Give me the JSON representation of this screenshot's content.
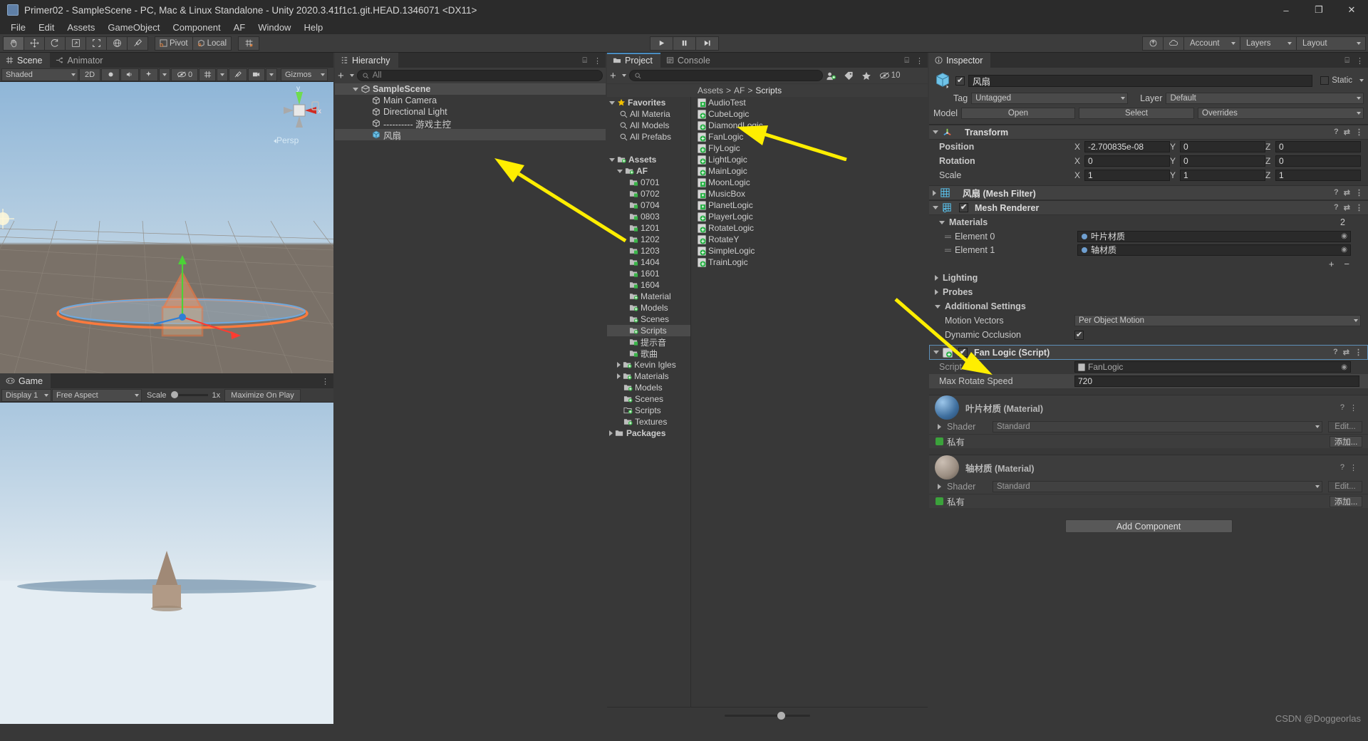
{
  "window": {
    "title": "Primer02 - SampleScene - PC, Mac & Linux Standalone - Unity 2020.3.41f1c1.git.HEAD.1346071 <DX11>",
    "minimize": "–",
    "maximize": "❐",
    "close": "✕"
  },
  "menubar": [
    "File",
    "Edit",
    "Assets",
    "GameObject",
    "Component",
    "AF",
    "Window",
    "Help"
  ],
  "toolbar": {
    "tools": [
      "hand-tool",
      "move-tool",
      "rotate-tool",
      "scale-tool",
      "rect-tool",
      "transform-tool",
      "custom-tool"
    ],
    "pivot": "Pivot",
    "space": "Local",
    "grid": "grid-snap",
    "play": "▶",
    "pause": "❙❙",
    "step": "▶❙",
    "cloud": "cloud-icon",
    "collab": "collab-icon",
    "account": "Account",
    "layers": "Layers",
    "layout": "Layout"
  },
  "scene": {
    "tabs": [
      {
        "label": "Scene",
        "icon": "grid-icon",
        "active": true
      },
      {
        "label": "Animator",
        "icon": "animator-icon",
        "active": false
      }
    ],
    "shading": "Shaded",
    "mode2d": "2D",
    "lighting": "lighting-icon",
    "audio": "audio-icon",
    "fx": "fx-icon",
    "visibility": "0",
    "grid": "grid-icon",
    "tools": "tools-icon",
    "camera": "camera-icon",
    "gizmos": "Gizmos",
    "gizmo_axes": {
      "y": "y",
      "x": "x",
      "persp": "Persp"
    }
  },
  "game": {
    "tab": "Game",
    "display": "Display 1",
    "aspect": "Free Aspect",
    "scale_label": "Scale",
    "scale_value": "1x",
    "maximize": "Maximize On Play"
  },
  "hierarchy": {
    "tab": "Hierarchy",
    "add": "+",
    "search_placeholder": "All",
    "lock_icon": "lock-icon",
    "menu_icon": "kebab-menu-icon",
    "items": [
      {
        "label": "SampleScene",
        "depth": 0,
        "icon": "scene-icon",
        "expanded": true,
        "selected": false
      },
      {
        "label": "Main Camera",
        "depth": 1,
        "icon": "gameobject-icon",
        "selected": false
      },
      {
        "label": "Directional Light",
        "depth": 1,
        "icon": "gameobject-icon",
        "selected": false
      },
      {
        "label": "---------- 游戏主控",
        "depth": 1,
        "icon": "gameobject-icon",
        "selected": false
      },
      {
        "label": "风扇",
        "depth": 1,
        "icon": "prefab-icon",
        "selected": true
      }
    ]
  },
  "project": {
    "tabs": [
      {
        "label": "Project",
        "icon": "folder-icon",
        "active": true
      },
      {
        "label": "Console",
        "icon": "console-icon",
        "active": false
      }
    ],
    "add": "+",
    "search_placeholder": "",
    "filter_icons": [
      "avatar-filter-icon",
      "label-filter-icon",
      "favorite-filter-icon"
    ],
    "hidden_count": "10",
    "breadcrumb": [
      "Assets",
      "AF",
      "Scripts"
    ],
    "tree": [
      {
        "label": "Favorites",
        "depth": 0,
        "icon": "star-icon",
        "expanded": true
      },
      {
        "label": "All Materia",
        "depth": 1,
        "icon": "search-icon"
      },
      {
        "label": "All Models",
        "depth": 1,
        "icon": "search-icon"
      },
      {
        "label": "All Prefabs",
        "depth": 1,
        "icon": "search-icon"
      },
      {
        "label": "",
        "depth": 0,
        "icon": "spacer"
      },
      {
        "label": "Assets",
        "depth": 0,
        "icon": "folder-icon",
        "expanded": true
      },
      {
        "label": "AF",
        "depth": 1,
        "icon": "folder-icon",
        "expanded": true
      },
      {
        "label": "0701",
        "depth": 2,
        "icon": "folder-icon"
      },
      {
        "label": "0702",
        "depth": 2,
        "icon": "folder-icon"
      },
      {
        "label": "0704",
        "depth": 2,
        "icon": "folder-icon"
      },
      {
        "label": "0803",
        "depth": 2,
        "icon": "folder-icon"
      },
      {
        "label": "1201",
        "depth": 2,
        "icon": "folder-icon"
      },
      {
        "label": "1202",
        "depth": 2,
        "icon": "folder-icon"
      },
      {
        "label": "1203",
        "depth": 2,
        "icon": "folder-icon"
      },
      {
        "label": "1404",
        "depth": 2,
        "icon": "folder-icon"
      },
      {
        "label": "1601",
        "depth": 2,
        "icon": "folder-icon"
      },
      {
        "label": "1604",
        "depth": 2,
        "icon": "folder-icon"
      },
      {
        "label": "Material",
        "depth": 2,
        "icon": "folder-icon"
      },
      {
        "label": "Models",
        "depth": 2,
        "icon": "folder-icon"
      },
      {
        "label": "Scenes",
        "depth": 2,
        "icon": "folder-icon"
      },
      {
        "label": "Scripts",
        "depth": 2,
        "icon": "folder-icon",
        "selected": true
      },
      {
        "label": "提示音",
        "depth": 2,
        "icon": "folder-icon"
      },
      {
        "label": "歌曲",
        "depth": 2,
        "icon": "folder-icon"
      },
      {
        "label": "Kevin Igles",
        "depth": 1,
        "icon": "folder-icon",
        "collapsed": true
      },
      {
        "label": "Materials",
        "depth": 1,
        "icon": "folder-icon",
        "collapsed": true
      },
      {
        "label": "Models",
        "depth": 1,
        "icon": "folder-icon"
      },
      {
        "label": "Scenes",
        "depth": 1,
        "icon": "folder-icon"
      },
      {
        "label": "Scripts",
        "depth": 1,
        "icon": "folder-open-icon"
      },
      {
        "label": "Textures",
        "depth": 1,
        "icon": "folder-icon"
      },
      {
        "label": "Packages",
        "depth": 0,
        "icon": "folder-icon",
        "collapsed": true
      }
    ],
    "files": [
      {
        "label": "AudioTest",
        "icon": "script-asset-icon"
      },
      {
        "label": "CubeLogic",
        "icon": "script-icon"
      },
      {
        "label": "DiamondLogic",
        "icon": "script-icon"
      },
      {
        "label": "FanLogic",
        "icon": "script-icon"
      },
      {
        "label": "FlyLogic",
        "icon": "script-icon"
      },
      {
        "label": "LightLogic",
        "icon": "script-icon"
      },
      {
        "label": "MainLogic",
        "icon": "script-icon"
      },
      {
        "label": "MoonLogic",
        "icon": "script-asset-icon"
      },
      {
        "label": "MusicBox",
        "icon": "script-asset-icon"
      },
      {
        "label": "PlanetLogic",
        "icon": "script-asset-icon"
      },
      {
        "label": "PlayerLogic",
        "icon": "script-icon"
      },
      {
        "label": "RotateLogic",
        "icon": "script-icon"
      },
      {
        "label": "RotateY",
        "icon": "script-icon"
      },
      {
        "label": "SimpleLogic",
        "icon": "script-icon"
      },
      {
        "label": "TrainLogic",
        "icon": "script-icon"
      }
    ]
  },
  "inspector": {
    "tab": "Inspector",
    "lock_icon": "lock-icon",
    "menu_icon": "kebab-menu-icon",
    "object_name": "风扇",
    "object_enabled": true,
    "static_label": "Static",
    "tag_label": "Tag",
    "tag_value": "Untagged",
    "layer_label": "Layer",
    "layer_value": "Default",
    "model_label": "Model",
    "model_open": "Open",
    "model_select": "Select",
    "model_overrides": "Overrides",
    "transform": {
      "title": "Transform",
      "rows": [
        {
          "name": "Position",
          "x": "-2.700835e-08",
          "y": "0",
          "z": "0"
        },
        {
          "name": "Rotation",
          "x": "0",
          "y": "0",
          "z": "0"
        },
        {
          "name": "Scale",
          "x": "1",
          "y": "1",
          "z": "1"
        }
      ],
      "axes": [
        "X",
        "Y",
        "Z"
      ]
    },
    "mesh_filter": {
      "title": "风扇 (Mesh Filter)"
    },
    "mesh_renderer": {
      "title": "Mesh Renderer",
      "enabled": true,
      "materials_label": "Materials",
      "materials_count": "2",
      "elements": [
        {
          "label": "Element 0",
          "value": "叶片材质"
        },
        {
          "label": "Element 1",
          "value": "轴材质"
        }
      ],
      "add_btn": "+",
      "remove_btn": "−",
      "lighting": "Lighting",
      "probes": "Probes",
      "additional_settings": "Additional Settings",
      "motion_vectors_label": "Motion Vectors",
      "motion_vectors_value": "Per Object Motion",
      "dynamic_occlusion_label": "Dynamic Occlusion",
      "dynamic_occlusion_value": true
    },
    "fan_logic": {
      "title": "Fan Logic (Script)",
      "enabled": true,
      "script_label": "Script",
      "script_value": "FanLogic",
      "max_rotate_speed_label": "Max Rotate Speed",
      "max_rotate_speed_value": "720"
    },
    "materials": [
      {
        "title": "叶片材质 (Material)",
        "shader_label": "Shader",
        "shader_value": "Standard",
        "edit_btn": "Edit...",
        "private_label": "私有",
        "add_btn": "添加...",
        "color": "#4a7fb8"
      },
      {
        "title": "轴材质 (Material)",
        "shader_label": "Shader",
        "shader_value": "Standard",
        "edit_btn": "Edit...",
        "private_label": "私有",
        "add_btn": "添加...",
        "color": "#8e8077"
      }
    ],
    "add_component": "Add Component"
  },
  "watermark": "CSDN @Doggeorlas",
  "colors": {
    "accent_blue": "#4a8ec2",
    "arrow_yellow": "#ffee00",
    "panel_bg": "#383838",
    "header_bg": "#3c3c3c"
  }
}
